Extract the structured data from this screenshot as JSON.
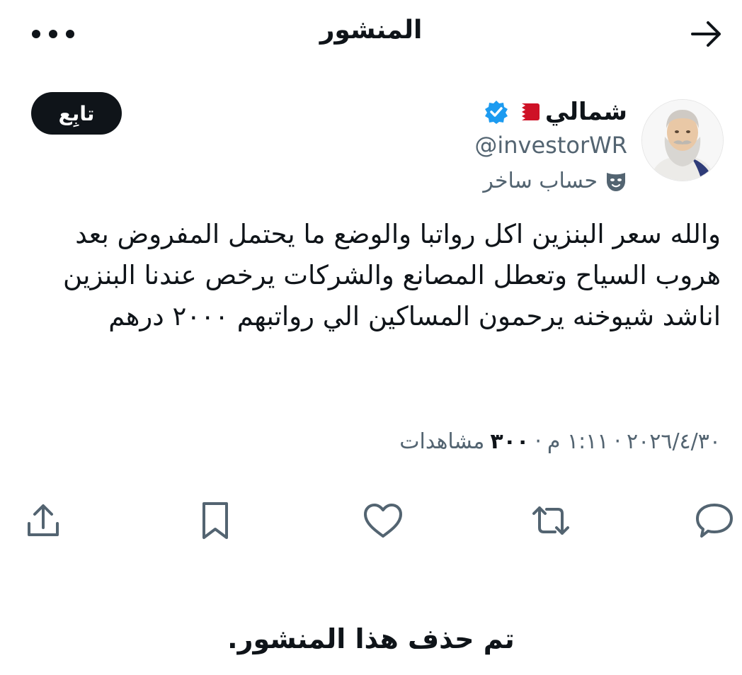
{
  "header": {
    "title": "المنشور"
  },
  "author": {
    "name": "شمالي",
    "handle": "@investorWR",
    "parody_label": "حساب ساخر",
    "verified": true,
    "flag": "bahrain-flag"
  },
  "follow_label": "تابِع",
  "post": {
    "text": "والله سعر البنزين اكل رواتبا والوضع ما يحتمل المفروض بعد هروب السياح وتعطل المصانع والشركات يرخص عندنا البنزين اناشد شيوخنه يرحمون المساكين الي رواتبهم ٢٠٠٠ درهم"
  },
  "meta": {
    "time": "١:١١ م",
    "separator": "·",
    "date": "٢٠٢٦/٤/٣٠",
    "views_count": "٣٠٠",
    "views_label": "مشاهدات"
  },
  "actions": [
    "reply-icon",
    "retweet-icon",
    "like-icon",
    "bookmark-icon",
    "share-icon"
  ],
  "deleted_notice": "تم حذف هذا المنشور.",
  "colors": {
    "text": "#0f1419",
    "secondary": "#536471",
    "verified": "#1d9bf0",
    "flag_red": "#ce1126"
  }
}
